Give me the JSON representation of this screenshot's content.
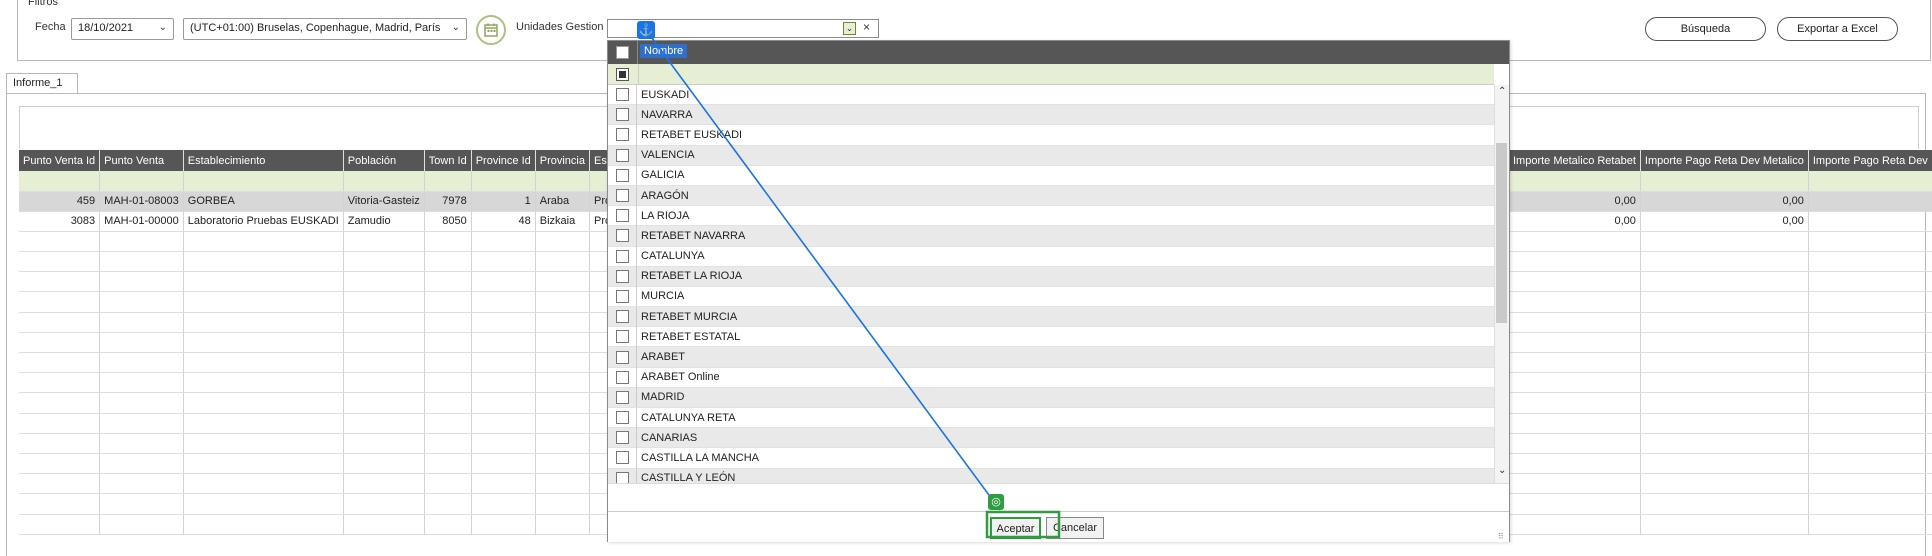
{
  "filters": {
    "section_label": "Filtros",
    "date_label": "Fecha",
    "date_value": "18/10/2021",
    "timezone_value": "(UTC+01:00) Bruselas, Copenhague, Madrid, París",
    "units_label": "Unidades Gestion",
    "search_button": "Búsqueda",
    "export_button": "Exportar a Excel"
  },
  "tabs": [
    "Informe_1"
  ],
  "report": {
    "columns": [
      "Punto Venta Id",
      "Punto Venta",
      "Establecimiento",
      "Población",
      "Town Id",
      "Province Id",
      "Provincia",
      "Estado"
    ],
    "right_columns": [
      "Importe Metalico Retabet",
      "Importe Pago Reta Dev Metalico",
      "Importe Pago Reta Dev"
    ],
    "rows": [
      {
        "id": "459",
        "pv": "MAH-01-08003",
        "est": "GORBEA",
        "pob": "Vitoria-Gasteiz",
        "town": "7978",
        "prov_id": "1",
        "prov": "Araba",
        "estado": "Produ",
        "imp1": "0,00",
        "imp2": "0,00"
      },
      {
        "id": "3083",
        "pv": "MAH-01-00000",
        "est": "Laboratorio Pruebas EUSKADI",
        "pob": "Zamudio",
        "town": "8050",
        "prov_id": "48",
        "prov": "Bizkaia",
        "estado": "Produ",
        "imp1": "0,00",
        "imp2": "0,00"
      }
    ]
  },
  "popup": {
    "header": "Nombre",
    "items": [
      "EUSKADI",
      "NAVARRA",
      "RETABET EUSKADI",
      "VALENCIA",
      "GALICIA",
      "ARAGÓN",
      "LA RIOJA",
      "RETABET NAVARRA",
      "CATALUNYA",
      "RETABET LA RIOJA",
      "MURCIA",
      "RETABET MURCIA",
      "RETABET ESTATAL",
      "ARABET",
      "ARABET Online",
      "MADRID",
      "CATALUNYA RETA",
      "CANARIAS",
      "CASTILLA LA MANCHA",
      "CASTILLA Y LEÓN"
    ],
    "accept_button": "Aceptar",
    "cancel_button": "Cancelar"
  },
  "colors": {
    "header": "#565656",
    "filter_row": "#e6efd4",
    "accent_blue": "#1a73e8",
    "accent_green": "#2e9c3f"
  },
  "icons": {
    "calendar": "calendar-icon",
    "anchor": "anchor-icon",
    "target": "target-icon"
  }
}
